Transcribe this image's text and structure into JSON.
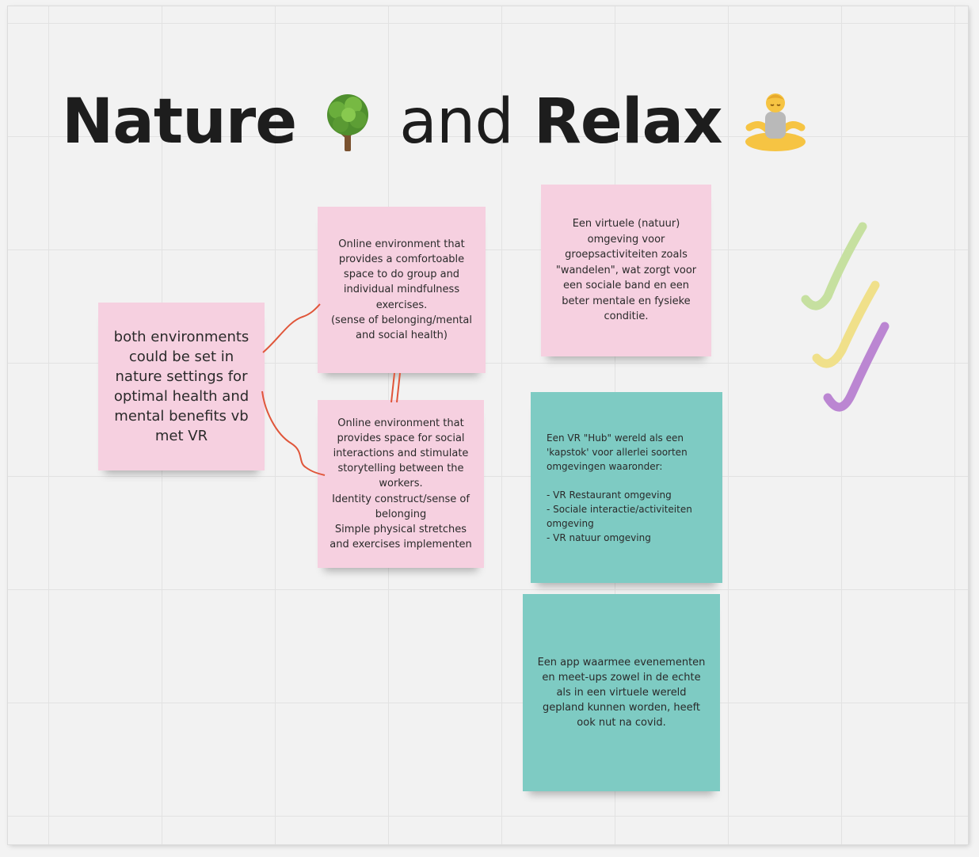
{
  "board": {
    "title": {
      "word1": "Nature",
      "word2": "and",
      "word3": "Relax",
      "icon1": "tree-icon",
      "icon2": "person-meditating-icon"
    },
    "sticky_notes": [
      {
        "id": "main",
        "color": "#f6d0e0",
        "text": "both environments could be set in nature settings for optimal health and mental benefits vb met VR"
      },
      {
        "id": "mindfulness",
        "color": "#f6d0e0",
        "text": "Online environment that provides a comfortoable space to do group and individual mindfulness exercises.\n(sense of belonging/mental and social health)"
      },
      {
        "id": "social",
        "color": "#f6d0e0",
        "text": "Online environment that provides space for social interactions and stimulate storytelling between the workers.\nIdentity construct/sense of belonging\nSimple physical stretches and exercises implementen"
      },
      {
        "id": "virtual-nature",
        "color": "#f6d0e0",
        "text": "Een virtuele (natuur) omgeving voor groepsactiviteiten zoals \"wandelen\", wat zorgt voor een sociale band en een beter mentale en fysieke conditie."
      },
      {
        "id": "vr-hub",
        "color": "#7ecbc3",
        "text": "Een VR \"Hub\" wereld als een 'kapstok' voor allerlei soorten omgevingen waaronder:\n\n- VR Restaurant omgeving\n- Sociale interactie/activiteiten omgeving\n- VR natuur omgeving"
      },
      {
        "id": "events-app",
        "color": "#7ecbc3",
        "text": "Een app waarmee evenementen en meet-ups zowel in de echte als in een virtuele wereld gepland kunnen worden, heeft ook nut na covid."
      }
    ],
    "connector_color": "#e0563a",
    "checkmarks": [
      {
        "color": "#c6e0a0",
        "icon": "checkmark-icon"
      },
      {
        "color": "#f0e08a",
        "icon": "checkmark-icon"
      },
      {
        "color": "#bb86d2",
        "icon": "checkmark-icon"
      }
    ]
  }
}
